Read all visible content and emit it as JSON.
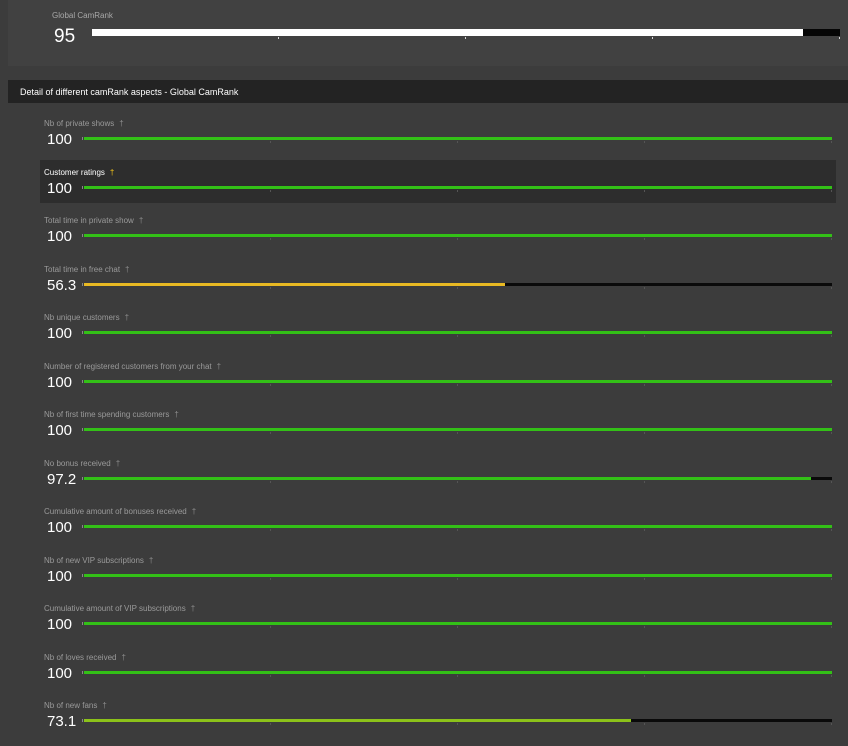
{
  "global": {
    "label": "Global CamRank",
    "value": "95",
    "score": 95
  },
  "section": {
    "title": "Detail of different camRank aspects - Global CamRank"
  },
  "colors": {
    "good": "#33c017",
    "warning": "#e8b923",
    "medium": "#8cc21a",
    "track": "#0a0a0a",
    "highlight_icon": "#f5c518"
  },
  "info_icon": "info-tip-icon",
  "metrics": [
    {
      "label": "Nb of private shows",
      "value": "100",
      "score": 100,
      "color": "#33c017",
      "highlight": false
    },
    {
      "label": "Customer ratings",
      "value": "100",
      "score": 100,
      "color": "#33c017",
      "highlight": true
    },
    {
      "label": "Total time in private show",
      "value": "100",
      "score": 100,
      "color": "#33c017",
      "highlight": false
    },
    {
      "label": "Total time in free chat",
      "value": "56.3",
      "score": 56.3,
      "color": "#e8b923",
      "highlight": false
    },
    {
      "label": "Nb unique customers",
      "value": "100",
      "score": 100,
      "color": "#33c017",
      "highlight": false
    },
    {
      "label": "Number of registered customers from your chat",
      "value": "100",
      "score": 100,
      "color": "#33c017",
      "highlight": false
    },
    {
      "label": "Nb of first time spending customers",
      "value": "100",
      "score": 100,
      "color": "#33c017",
      "highlight": false
    },
    {
      "label": "No bonus received",
      "value": "97.2",
      "score": 97.2,
      "color": "#33c017",
      "highlight": false
    },
    {
      "label": "Cumulative amount of bonuses received",
      "value": "100",
      "score": 100,
      "color": "#33c017",
      "highlight": false
    },
    {
      "label": "Nb of new VIP subscriptions",
      "value": "100",
      "score": 100,
      "color": "#33c017",
      "highlight": false
    },
    {
      "label": "Cumulative amount of VIP subscriptions",
      "value": "100",
      "score": 100,
      "color": "#33c017",
      "highlight": false
    },
    {
      "label": "Nb of loves received",
      "value": "100",
      "score": 100,
      "color": "#33c017",
      "highlight": false
    },
    {
      "label": "Nb of new fans",
      "value": "73.1",
      "score": 73.1,
      "color": "#8cc21a",
      "highlight": false
    }
  ]
}
